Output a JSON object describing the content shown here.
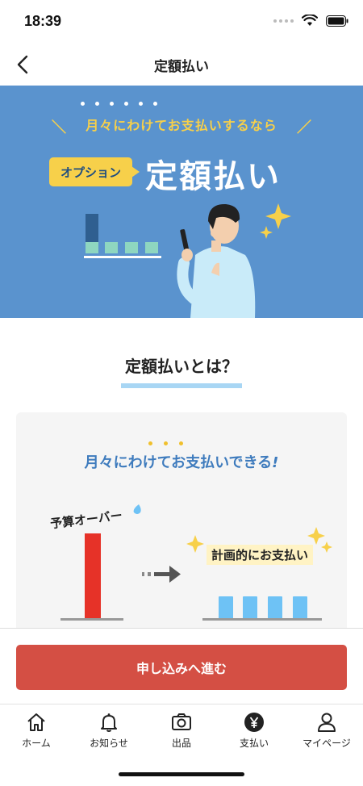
{
  "status_bar": {
    "time": "18:39"
  },
  "nav": {
    "title": "定額払い"
  },
  "hero": {
    "subtitle": "月々にわけてお支払いするなら",
    "badge": "オプション",
    "title": "定額払い"
  },
  "section": {
    "title": "定額払いとは？"
  },
  "card": {
    "headline": "月々にわけてお支払いできる",
    "over_label": "予算オーバー",
    "plan_label": "計画的にお支払い"
  },
  "cta": {
    "label": "申し込みへ進む"
  },
  "tabs": [
    {
      "label": "ホーム",
      "icon": "home-icon"
    },
    {
      "label": "お知らせ",
      "icon": "bell-icon"
    },
    {
      "label": "出品",
      "icon": "camera-icon"
    },
    {
      "label": "支払い",
      "icon": "yen-icon"
    },
    {
      "label": "マイページ",
      "icon": "person-icon"
    }
  ],
  "colors": {
    "hero_bg": "#5a93ce",
    "accent_yellow": "#f7d04a",
    "cta": "#d44f44",
    "headline_blue": "#3e7bbd",
    "bar_red": "#e63228",
    "bar_blue": "#6ec2f5"
  }
}
